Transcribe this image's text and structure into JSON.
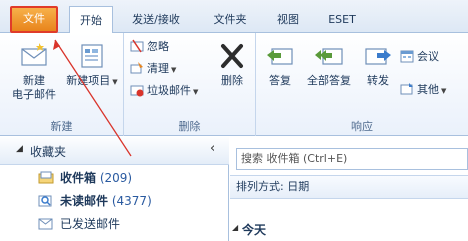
{
  "tabs": {
    "file": "文件",
    "home": "开始",
    "send_receive": "发送/接收",
    "folder": "文件夹",
    "view": "视图",
    "eset": "ESET"
  },
  "ribbon": {
    "new_group": {
      "label": "新建",
      "new_email_line1": "新建",
      "new_email_line2": "电子邮件",
      "new_items": "新建项目"
    },
    "delete_group": {
      "label": "删除",
      "ignore": "忽略",
      "cleanup": "清理",
      "junk": "垃圾邮件",
      "delete": "删除"
    },
    "respond_group": {
      "label": "响应",
      "reply": "答复",
      "reply_all": "全部答复",
      "forward": "转发",
      "meeting": "会议",
      "more": "其他"
    }
  },
  "nav": {
    "favorites": "收藏夹",
    "folders": [
      {
        "name": "收件箱",
        "count": "(209)"
      },
      {
        "name": "未读邮件",
        "count": "(4377)"
      },
      {
        "name": "已发送邮件",
        "count": ""
      }
    ]
  },
  "mail": {
    "search_placeholder": "搜索 收件箱 (Ctrl+E)",
    "sort_by": "排列方式: 日期",
    "today": "今天"
  },
  "colors": {
    "file_tab": "#e8841c",
    "highlight_border": "#e03b2a",
    "annotation_arrow": "#d9342b"
  }
}
